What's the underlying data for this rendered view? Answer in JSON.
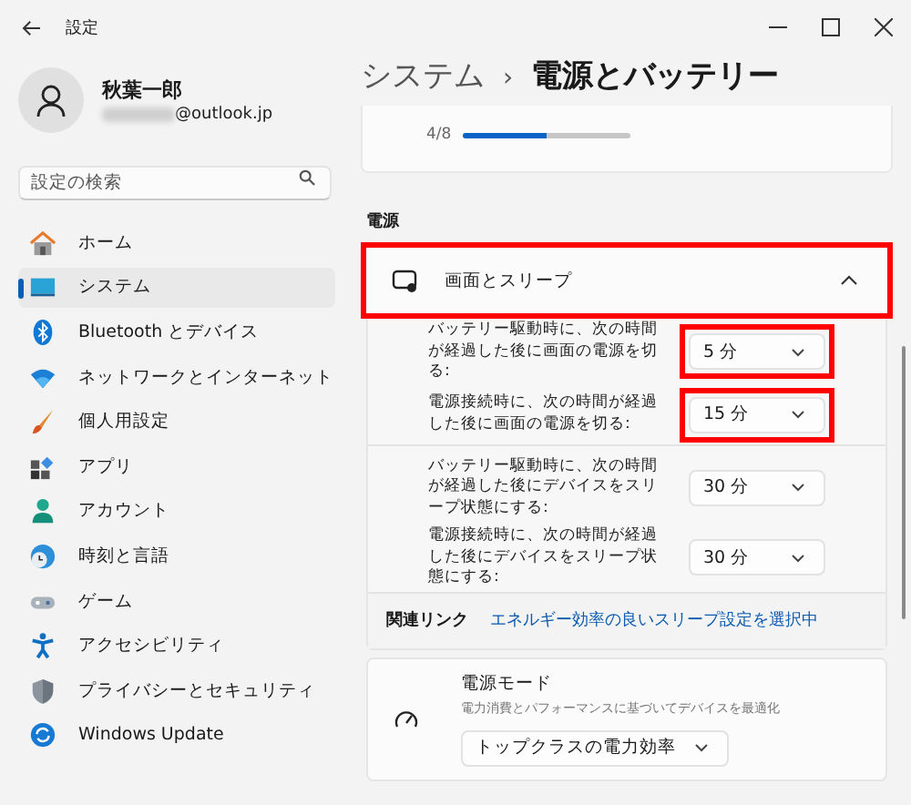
{
  "window": {
    "title": "設定"
  },
  "user": {
    "name": "秋葉一郎",
    "email": "@outlook.jp"
  },
  "search": {
    "placeholder": "設定の検索"
  },
  "sidebar": {
    "items": [
      {
        "label": "ホーム",
        "selected": false
      },
      {
        "label": "システム",
        "selected": true
      },
      {
        "label": "Bluetooth とデバイス",
        "selected": false
      },
      {
        "label": "ネットワークとインターネット",
        "selected": false
      },
      {
        "label": "個人用設定",
        "selected": false
      },
      {
        "label": "アプリ",
        "selected": false
      },
      {
        "label": "アカウント",
        "selected": false
      },
      {
        "label": "時刻と言語",
        "selected": false
      },
      {
        "label": "ゲーム",
        "selected": false
      },
      {
        "label": "アクセシビリティ",
        "selected": false
      },
      {
        "label": "プライバシーとセキュリティ",
        "selected": false
      },
      {
        "label": "Windows Update",
        "selected": false
      }
    ]
  },
  "breadcrumb": {
    "parent": "システム",
    "separator": "›",
    "current": "電源とバッテリー"
  },
  "top_card": {
    "reading": "4/8",
    "level": 0.5
  },
  "section_label": "電源",
  "screen_sleep": {
    "title": "画面とスリープ",
    "expanded": true,
    "highlighted": true,
    "rows": [
      {
        "label": "バッテリー駆動時に、次の時間が経過した後に画面の電源を切る:",
        "value": "5 分",
        "highlighted": true
      },
      {
        "label": "電源接続時に、次の時間が経過した後に画面の電源を切る:",
        "value": "15 分",
        "highlighted": true
      },
      {
        "label": "バッテリー駆動時に、次の時間が経過した後にデバイスをスリープ状態にする:",
        "value": "30 分",
        "highlighted": false
      },
      {
        "label": "電源接続時に、次の時間が経過した後にデバイスをスリープ状態にする:",
        "value": "30 分",
        "highlighted": false
      }
    ]
  },
  "related": {
    "label": "関連リンク",
    "link": "エネルギー効率の良いスリープ設定を選択中"
  },
  "power_mode": {
    "title": "電源モード",
    "description": "電力消費とパフォーマンスに基づいてデバイスを最適化",
    "value": "トップクラスの電力効率"
  }
}
